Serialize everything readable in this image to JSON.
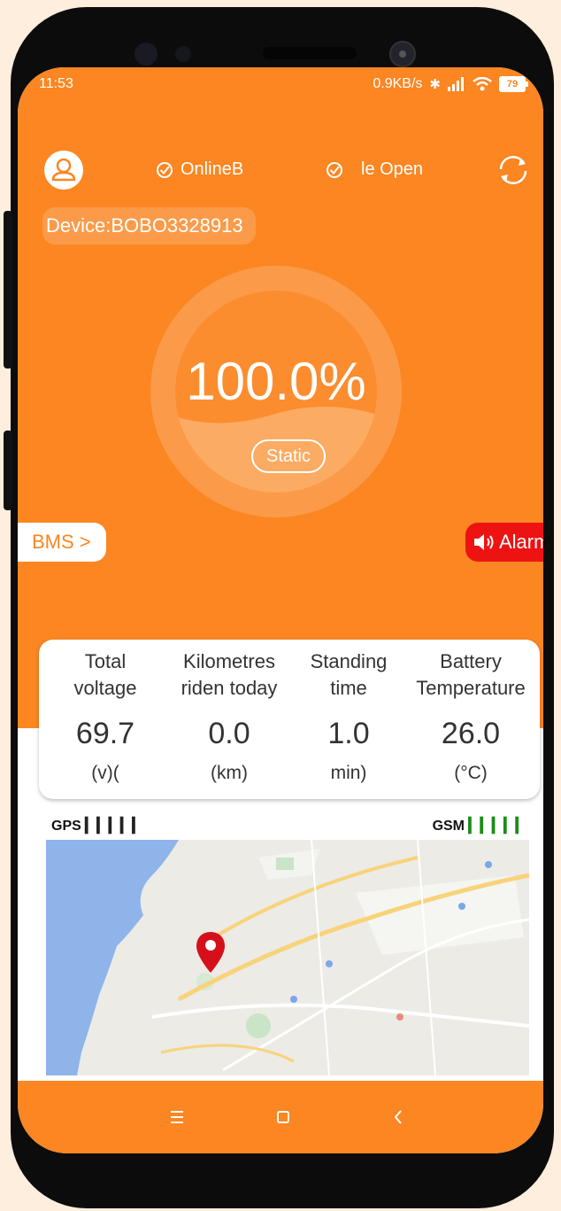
{
  "status_bar": {
    "time": "11:53",
    "speed": "0.9KB/s",
    "battery": "79"
  },
  "header": {
    "online_label": "OnlineB",
    "open_label": "le Open"
  },
  "device": {
    "label": "Device:BOBO3328913"
  },
  "gauge": {
    "percent_text": "100.0%",
    "state": "Static"
  },
  "actions": {
    "bms": "BMS  >",
    "alarm": "Alarm"
  },
  "stats": [
    {
      "label_line1": "Total",
      "label_line2": "voltage",
      "value": "69.7",
      "unit": "(v)("
    },
    {
      "label_line1": "Kilometres",
      "label_line2": "riden today",
      "value": "0.0",
      "unit": "(km)"
    },
    {
      "label_line1": "Standing",
      "label_line2": "time",
      "value": "1.0",
      "unit": "min)"
    },
    {
      "label_line1": "Battery",
      "label_line2": "Temperature",
      "value": "26.0",
      "unit": "(°C)"
    }
  ],
  "signals": {
    "gps_label": "GPS",
    "gsm_label": "GSM"
  },
  "colors": {
    "accent": "#fb8622",
    "alarm": "#ee1313",
    "gsm_bars": "#1a8c1a"
  },
  "icons": {
    "user": "user-icon",
    "check": "check-circle-icon",
    "refresh": "refresh-icon",
    "speaker": "speaker-icon",
    "pin": "map-pin-icon"
  }
}
